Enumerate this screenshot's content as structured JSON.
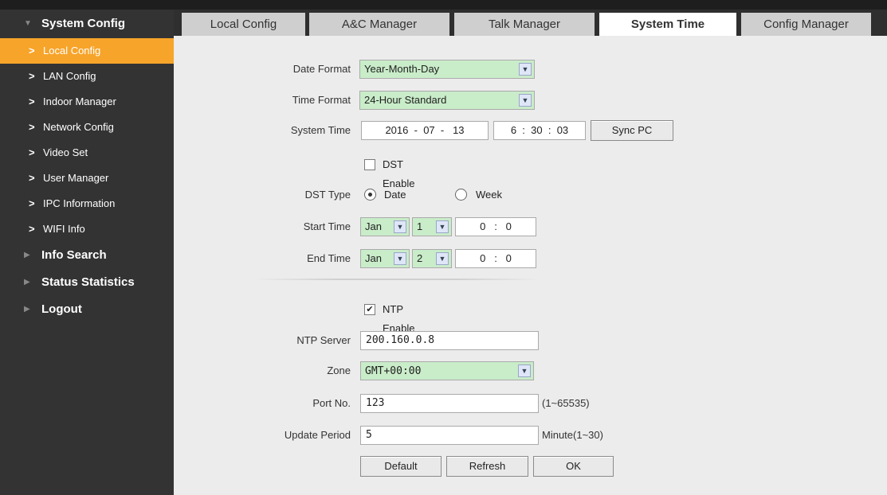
{
  "sidebar": {
    "sections": [
      {
        "label": "System Config"
      },
      {
        "label": "Info Search"
      },
      {
        "label": "Status Statistics"
      },
      {
        "label": "Logout"
      }
    ],
    "items": [
      {
        "label": "Local Config"
      },
      {
        "label": "LAN Config"
      },
      {
        "label": "Indoor Manager"
      },
      {
        "label": "Network Config"
      },
      {
        "label": "Video Set"
      },
      {
        "label": "User Manager"
      },
      {
        "label": "IPC Information"
      },
      {
        "label": "WIFI Info"
      }
    ],
    "item_chevron": ">",
    "expanded_icon": "triangle-down-icon",
    "collapsed_icon": "triangle-right-icon",
    "active_color": "#f7a42a"
  },
  "tabs": [
    {
      "label": "Local Config"
    },
    {
      "label": "A&C Manager"
    },
    {
      "label": "Talk Manager"
    },
    {
      "label": "System Time"
    },
    {
      "label": "Config Manager"
    }
  ],
  "form": {
    "date_format": {
      "label": "Date Format",
      "value": "Year-Month-Day"
    },
    "time_format": {
      "label": "Time Format",
      "value": "24-Hour Standard"
    },
    "system_time": {
      "label": "System Time",
      "year": "2016",
      "month": "07",
      "day": "13",
      "hour": "6",
      "minute": "30",
      "second": "03",
      "date_sep": "-",
      "time_sep": ":",
      "sync_label": "Sync PC"
    },
    "dst_enable": {
      "label": "DST Enable",
      "checked": false
    },
    "dst_type": {
      "label": "DST Type",
      "date_label": "Date",
      "week_label": "Week",
      "selected": "Date"
    },
    "start_time": {
      "label": "Start Time",
      "month": "Jan",
      "day": "1",
      "hour": "0",
      "minute": "0"
    },
    "end_time": {
      "label": "End Time",
      "month": "Jan",
      "day": "2",
      "hour": "0",
      "minute": "0"
    },
    "ntp_enable": {
      "label": "NTP Enable",
      "checked": true,
      "mark": "✔"
    },
    "ntp_server": {
      "label": "NTP Server",
      "value": "200.160.0.8"
    },
    "zone": {
      "label": "Zone",
      "value": "GMT+00:00"
    },
    "port": {
      "label": "Port No.",
      "value": "123",
      "hint": "(1~65535)"
    },
    "update_period": {
      "label": "Update Period",
      "value": "5",
      "hint": "Minute(1~30)"
    },
    "buttons": {
      "default": "Default",
      "refresh": "Refresh",
      "ok": "OK"
    }
  },
  "colors": {
    "select_bg": "#c9ecc9",
    "sidebar_bg": "#333333",
    "content_bg": "#ececec"
  }
}
